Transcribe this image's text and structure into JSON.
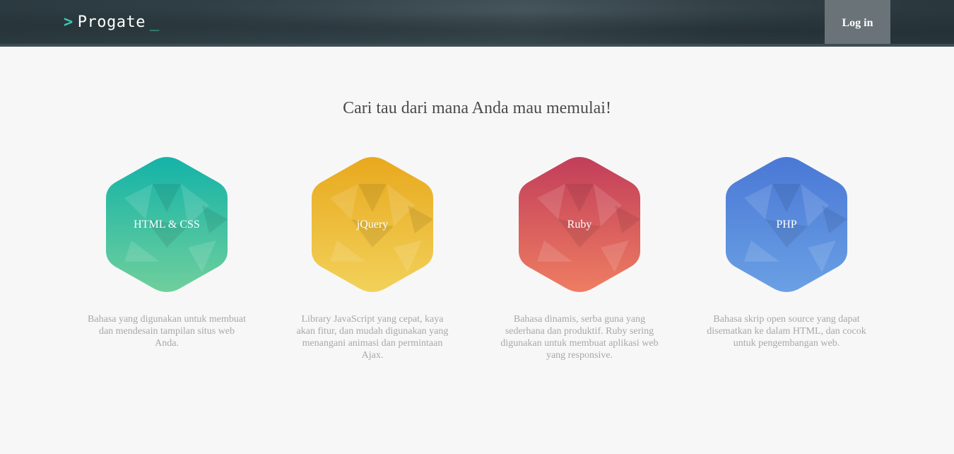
{
  "header": {
    "logo_text": "Progate",
    "logo_prefix": ">",
    "logo_cursor": "_",
    "login_label": "Log in"
  },
  "main": {
    "title": "Cari tau dari mana Anda mau memulai!"
  },
  "courses": [
    {
      "label": "HTML & CSS",
      "description": "Bahasa yang digunakan untuk membuat dan mendesain tampilan situs web Anda.",
      "color_top": "#14b3a8",
      "color_bottom": "#6fcf9c"
    },
    {
      "label": "jQuery",
      "description": "Library JavaScript yang cepat, kaya akan fitur, dan mudah digunakan yang menangani animasi dan permintaan Ajax.",
      "color_top": "#e8a91e",
      "color_bottom": "#f2d15a"
    },
    {
      "label": "Ruby",
      "description": "Bahasa dinamis, serba guna yang sederhana dan produktif. Ruby sering digunakan untuk membuat aplikasi web yang responsive.",
      "color_top": "#c23e5a",
      "color_bottom": "#ee7d62"
    },
    {
      "label": "PHP",
      "description": "Bahasa skrip open source yang dapat disematkan ke dalam HTML, dan cocok untuk pengembangan web.",
      "color_top": "#4a78d6",
      "color_bottom": "#6aa0e4"
    }
  ]
}
